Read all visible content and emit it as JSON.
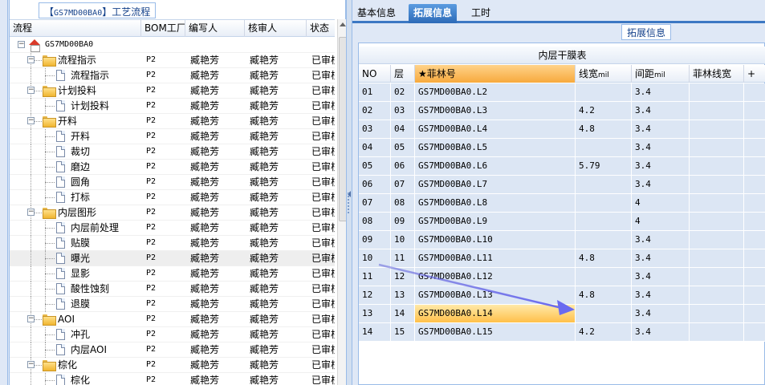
{
  "left": {
    "title_prefix": "【",
    "title_code": "GS7MD00BA0",
    "title_suffix": "】工艺流程",
    "columns": [
      "流程",
      "BOM工厂",
      "编写人",
      "核审人",
      "状态"
    ],
    "rows": [
      {
        "label": "GS7MD00BA0",
        "type": "root",
        "factory": "",
        "author": "",
        "reviewer": "",
        "status": ""
      },
      {
        "label": "流程指示",
        "type": "folder",
        "factory": "P2",
        "author": "臧艳芳",
        "reviewer": "臧艳芳",
        "status": "已审核"
      },
      {
        "label": "流程指示",
        "type": "doc",
        "factory": "P2",
        "author": "臧艳芳",
        "reviewer": "臧艳芳",
        "status": "已审核"
      },
      {
        "label": "计划投料",
        "type": "folder",
        "factory": "P2",
        "author": "臧艳芳",
        "reviewer": "臧艳芳",
        "status": "已审核"
      },
      {
        "label": "计划投料",
        "type": "doc",
        "factory": "P2",
        "author": "臧艳芳",
        "reviewer": "臧艳芳",
        "status": "已审核"
      },
      {
        "label": "开料",
        "type": "folder",
        "factory": "P2",
        "author": "臧艳芳",
        "reviewer": "臧艳芳",
        "status": "已审核"
      },
      {
        "label": "开料",
        "type": "doc",
        "factory": "P2",
        "author": "臧艳芳",
        "reviewer": "臧艳芳",
        "status": "已审核"
      },
      {
        "label": "裁切",
        "type": "doc",
        "factory": "P2",
        "author": "臧艳芳",
        "reviewer": "臧艳芳",
        "status": "已审核"
      },
      {
        "label": "磨边",
        "type": "doc",
        "factory": "P2",
        "author": "臧艳芳",
        "reviewer": "臧艳芳",
        "status": "已审核"
      },
      {
        "label": "圆角",
        "type": "doc",
        "factory": "P2",
        "author": "臧艳芳",
        "reviewer": "臧艳芳",
        "status": "已审核"
      },
      {
        "label": "打标",
        "type": "doc",
        "factory": "P2",
        "author": "臧艳芳",
        "reviewer": "臧艳芳",
        "status": "已审核"
      },
      {
        "label": "内层图形",
        "type": "folder",
        "factory": "P2",
        "author": "臧艳芳",
        "reviewer": "臧艳芳",
        "status": "已审核"
      },
      {
        "label": "内层前处理",
        "type": "doc",
        "factory": "P2",
        "author": "臧艳芳",
        "reviewer": "臧艳芳",
        "status": "已审核"
      },
      {
        "label": "贴膜",
        "type": "doc",
        "factory": "P2",
        "author": "臧艳芳",
        "reviewer": "臧艳芳",
        "status": "已审核"
      },
      {
        "label": "曝光",
        "type": "doc",
        "factory": "P2",
        "author": "臧艳芳",
        "reviewer": "臧艳芳",
        "status": "已审核",
        "selected": true
      },
      {
        "label": "显影",
        "type": "doc",
        "factory": "P2",
        "author": "臧艳芳",
        "reviewer": "臧艳芳",
        "status": "已审核"
      },
      {
        "label": "酸性蚀刻",
        "type": "doc",
        "factory": "P2",
        "author": "臧艳芳",
        "reviewer": "臧艳芳",
        "status": "已审核"
      },
      {
        "label": "退膜",
        "type": "doc",
        "factory": "P2",
        "author": "臧艳芳",
        "reviewer": "臧艳芳",
        "status": "已审核"
      },
      {
        "label": "AOI",
        "type": "folder",
        "factory": "P2",
        "author": "臧艳芳",
        "reviewer": "臧艳芳",
        "status": "已审核"
      },
      {
        "label": "冲孔",
        "type": "doc",
        "factory": "P2",
        "author": "臧艳芳",
        "reviewer": "臧艳芳",
        "status": "已审核"
      },
      {
        "label": "内层AOI",
        "type": "doc",
        "factory": "P2",
        "author": "臧艳芳",
        "reviewer": "臧艳芳",
        "status": "已审核"
      },
      {
        "label": "棕化",
        "type": "folder",
        "factory": "P2",
        "author": "臧艳芳",
        "reviewer": "臧艳芳",
        "status": "已审核"
      },
      {
        "label": "棕化",
        "type": "doc",
        "factory": "P2",
        "author": "臧艳芳",
        "reviewer": "臧艳芳",
        "status": "已审核"
      }
    ]
  },
  "right": {
    "tabs": [
      "基本信息",
      "拓展信息",
      "工时"
    ],
    "active_tab": 1,
    "section_label": "拓展信息",
    "grid_title": "内层干膜表",
    "columns": [
      {
        "label": "NO",
        "unit": ""
      },
      {
        "label": "层",
        "unit": ""
      },
      {
        "label": "★菲林号",
        "unit": ""
      },
      {
        "label": "线宽",
        "unit": "mil"
      },
      {
        "label": "间距",
        "unit": "mil"
      },
      {
        "label": "菲林线宽",
        "unit": ""
      },
      {
        "label": "+",
        "unit": ""
      }
    ],
    "rows": [
      [
        "01",
        "02",
        "GS7MD00BA0.L2",
        "",
        "3.4",
        ""
      ],
      [
        "02",
        "03",
        "GS7MD00BA0.L3",
        "4.2",
        "3.4",
        ""
      ],
      [
        "03",
        "04",
        "GS7MD00BA0.L4",
        "4.8",
        "3.4",
        ""
      ],
      [
        "04",
        "05",
        "GS7MD00BA0.L5",
        "",
        "3.4",
        ""
      ],
      [
        "05",
        "06",
        "GS7MD00BA0.L6",
        "5.79",
        "3.4",
        ""
      ],
      [
        "06",
        "07",
        "GS7MD00BA0.L7",
        "",
        "3.4",
        ""
      ],
      [
        "07",
        "08",
        "GS7MD00BA0.L8",
        "",
        "4",
        ""
      ],
      [
        "08",
        "09",
        "GS7MD00BA0.L9",
        "",
        "4",
        ""
      ],
      [
        "09",
        "10",
        "GS7MD00BA0.L10",
        "",
        "3.4",
        ""
      ],
      [
        "10",
        "11",
        "GS7MD00BA0.L11",
        "4.8",
        "3.4",
        ""
      ],
      [
        "11",
        "12",
        "GS7MD00BA0.L12",
        "",
        "3.4",
        ""
      ],
      [
        "12",
        "13",
        "GS7MD00BA0.L13",
        "4.8",
        "3.4",
        ""
      ],
      [
        "13",
        "14",
        "GS7MD00BA0.L14",
        "",
        "3.4",
        ""
      ],
      [
        "14",
        "15",
        "GS7MD00BA0.L15",
        "4.2",
        "3.4",
        ""
      ]
    ],
    "highlight_row": 12,
    "highlight_col": 2
  },
  "colors": {
    "accent": "#3c78c3",
    "highlight": "#ffc04a",
    "grid_cell": "#dce6f4",
    "annotation_arrow": "#6a6af0"
  },
  "icons": {
    "root": "home-icon",
    "folder": "folder-icon",
    "doc": "document-icon"
  }
}
